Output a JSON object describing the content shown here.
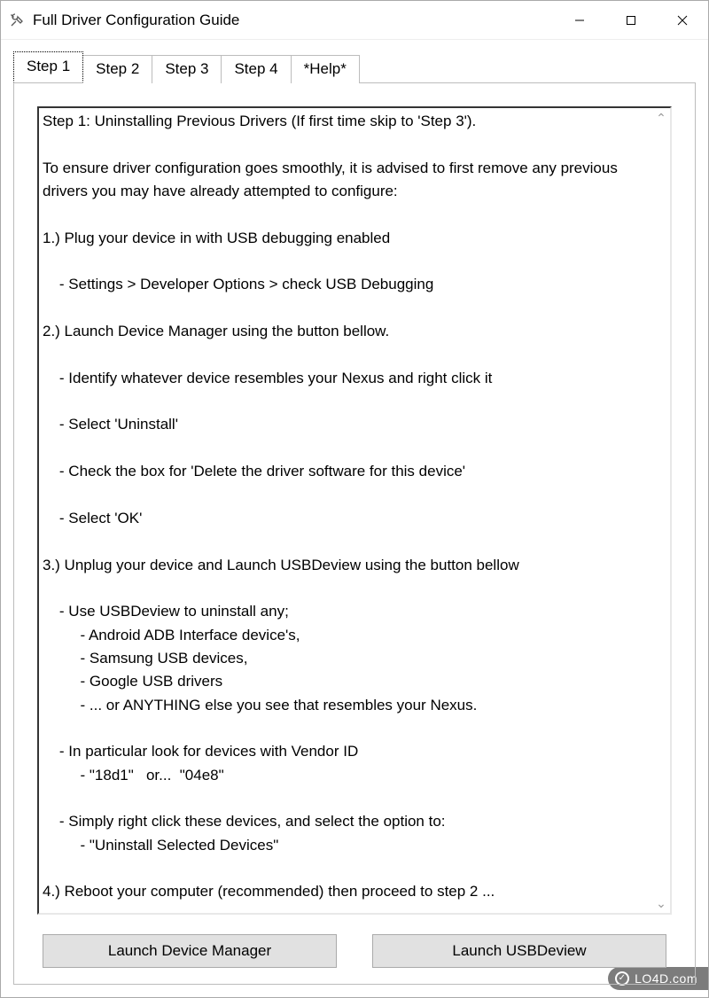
{
  "window": {
    "title": "Full Driver Configuration Guide"
  },
  "tabs": {
    "items": [
      {
        "label": "Step 1",
        "active": true
      },
      {
        "label": "Step 2",
        "active": false
      },
      {
        "label": "Step 3",
        "active": false
      },
      {
        "label": "Step 4",
        "active": false
      },
      {
        "label": "*Help*",
        "active": false
      }
    ]
  },
  "instructions": {
    "text": "Step 1: Uninstalling Previous Drivers (If first time skip to 'Step 3').\n\nTo ensure driver configuration goes smoothly, it is advised to first remove any previous drivers you may have already attempted to configure:\n\n1.) Plug your device in with USB debugging enabled\n\n    - Settings > Developer Options > check USB Debugging\n\n2.) Launch Device Manager using the button bellow.\n\n    - Identify whatever device resembles your Nexus and right click it\n\n    - Select 'Uninstall'\n\n    - Check the box for 'Delete the driver software for this device'\n\n    - Select 'OK'\n\n3.) Unplug your device and Launch USBDeview using the button bellow\n\n    - Use USBDeview to uninstall any;\n         - Android ADB Interface device's,\n         - Samsung USB devices,\n         - Google USB drivers\n         - ... or ANYTHING else you see that resembles your Nexus.\n\n    - In particular look for devices with Vendor ID\n         - \"18d1\"   or...  \"04e8\"\n\n    - Simply right click these devices, and select the option to:\n         - \"Uninstall Selected Devices\"\n\n4.) Reboot your computer (recommended) then proceed to step 2 ..."
  },
  "buttons": {
    "device_manager": "Launch Device Manager",
    "usbdeview": "Launch USBDeview"
  },
  "watermark": {
    "text": "LO4D.com"
  }
}
